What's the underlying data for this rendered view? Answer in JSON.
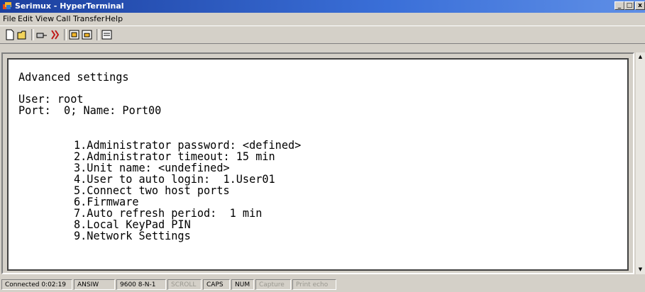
{
  "window": {
    "title": "Serimux - HyperTerminal",
    "controls": {
      "minimize": "_",
      "maximize": "□",
      "close": "x"
    }
  },
  "menu": [
    "File",
    "Edit",
    "View",
    "Call",
    "Transfer",
    "Help"
  ],
  "toolbar": {
    "icons": [
      "new-icon",
      "open-icon",
      "disconnect-icon",
      "call-icon",
      "send-icon",
      "receive-icon",
      "properties-icon"
    ]
  },
  "terminal": {
    "heading": "Advanced settings",
    "user_line": "User: root",
    "port_line": "Port:  0; Name: Port00",
    "options": [
      "1.Administrator password: <defined>",
      "2.Administrator timeout: 15 min",
      "3.Unit name: <undefined>",
      "4.User to auto login:  1.User01",
      "5.Connect two host ports",
      "6.Firmware",
      "7.Auto refresh period:  1 min",
      "8.Local KeyPad PIN",
      "9.Network Settings"
    ]
  },
  "statusbar": {
    "connected": "Connected 0:02:19",
    "emulation": "ANSIW",
    "settings": "9600 8-N-1",
    "scroll": "SCROLL",
    "caps": "CAPS",
    "num": "NUM",
    "capture": "Capture",
    "print_echo": "Print echo"
  }
}
